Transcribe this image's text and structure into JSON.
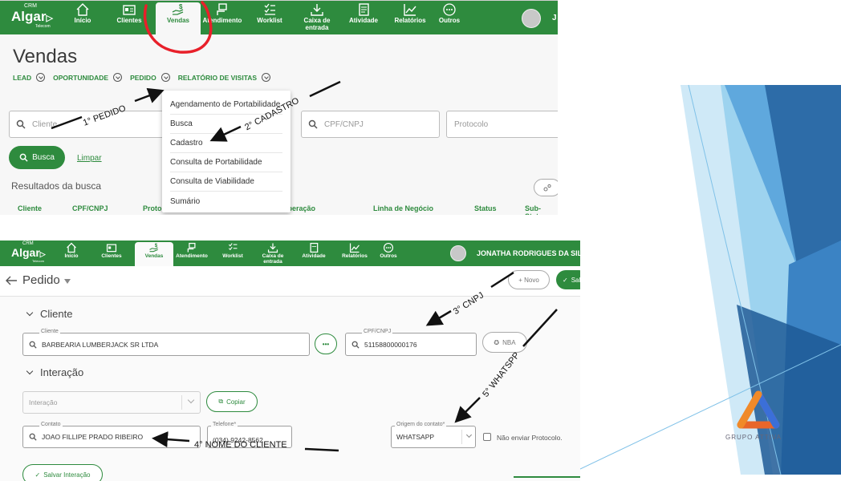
{
  "top": {
    "brand": {
      "name": "Algar",
      "crm": "CRM",
      "sub": "Telecom"
    },
    "nav": [
      "Início",
      "Clientes",
      "Vendas",
      "Atendimento",
      "Worklist",
      "Caixa de entrada",
      "Atividade",
      "Relatórios",
      "Outros"
    ],
    "active_nav": "Vendas",
    "user_initial": "J",
    "page_title": "Vendas",
    "subnav": [
      "LEAD",
      "OPORTUNIDADE",
      "PEDIDO",
      "RELATÓRIO DE VISITAS"
    ],
    "search_fields": {
      "cliente": "Cliente",
      "cpf": "CPF/CNPJ",
      "protocolo": "Protocolo"
    },
    "search_button": "Busca",
    "clear_link": "Limpar",
    "results_title": "Resultados da busca",
    "columns": [
      "Cliente",
      "CPF/CNPJ",
      "Proto",
      "e Operação",
      "Linha de Negócio",
      "Status",
      "Sub-Status"
    ],
    "dropdown": [
      "Agendamento de Portabilidade",
      "Busca",
      "Cadastro",
      "Consulta de Portabilidade",
      "Consulta de Viabilidade",
      "Sumário"
    ]
  },
  "bottom": {
    "brand": {
      "name": "Algar",
      "crm": "CRM",
      "sub": "Telecom"
    },
    "nav": [
      "Início",
      "Clientes",
      "Vendas",
      "Atendimento",
      "Worklist",
      "Caixa de entrada",
      "Atividade",
      "Relatórios",
      "Outros"
    ],
    "active_nav": "Vendas",
    "user_name": "JONATHA RODRIGUES DA SILVA",
    "page_title": "Pedido",
    "new_button": "+ Novo",
    "save_button": "Sal",
    "section_client": "Cliente",
    "client_label": "Cliente",
    "client_value": "BARBEARIA LUMBERJACK SR LTDA",
    "cpf_label": "CPF/CNPJ",
    "cpf_value": "51158800000176",
    "nba_button": "NBA",
    "section_interaction": "Interação",
    "interaction_placeholder": "Interação",
    "copy_button": "Copiar",
    "contact_label": "Contato",
    "contact_value": "JOAO FILLIPE PRADO RIBEIRO",
    "phone_label": "Telefone*",
    "phone_value": "(034) 9242-8562",
    "origin_label": "Origem do contato*",
    "origin_value": "WHATSAPP",
    "no_protocol_label": "Não enviar Protocolo.",
    "save_interaction": "Salvar Interação"
  },
  "annotations": [
    "1° PEDIDO",
    "2° CADASTRO",
    "3° CNPJ",
    "4° NOME DO CLIENTE",
    "5° WHATSPP"
  ],
  "slide": {
    "brand_text": "GRUPO ATTIVA"
  },
  "colors": {
    "brand_green": "#2e8b3e",
    "highlight_red": "#e8202a",
    "slide_blue": "#2d6ca8"
  }
}
